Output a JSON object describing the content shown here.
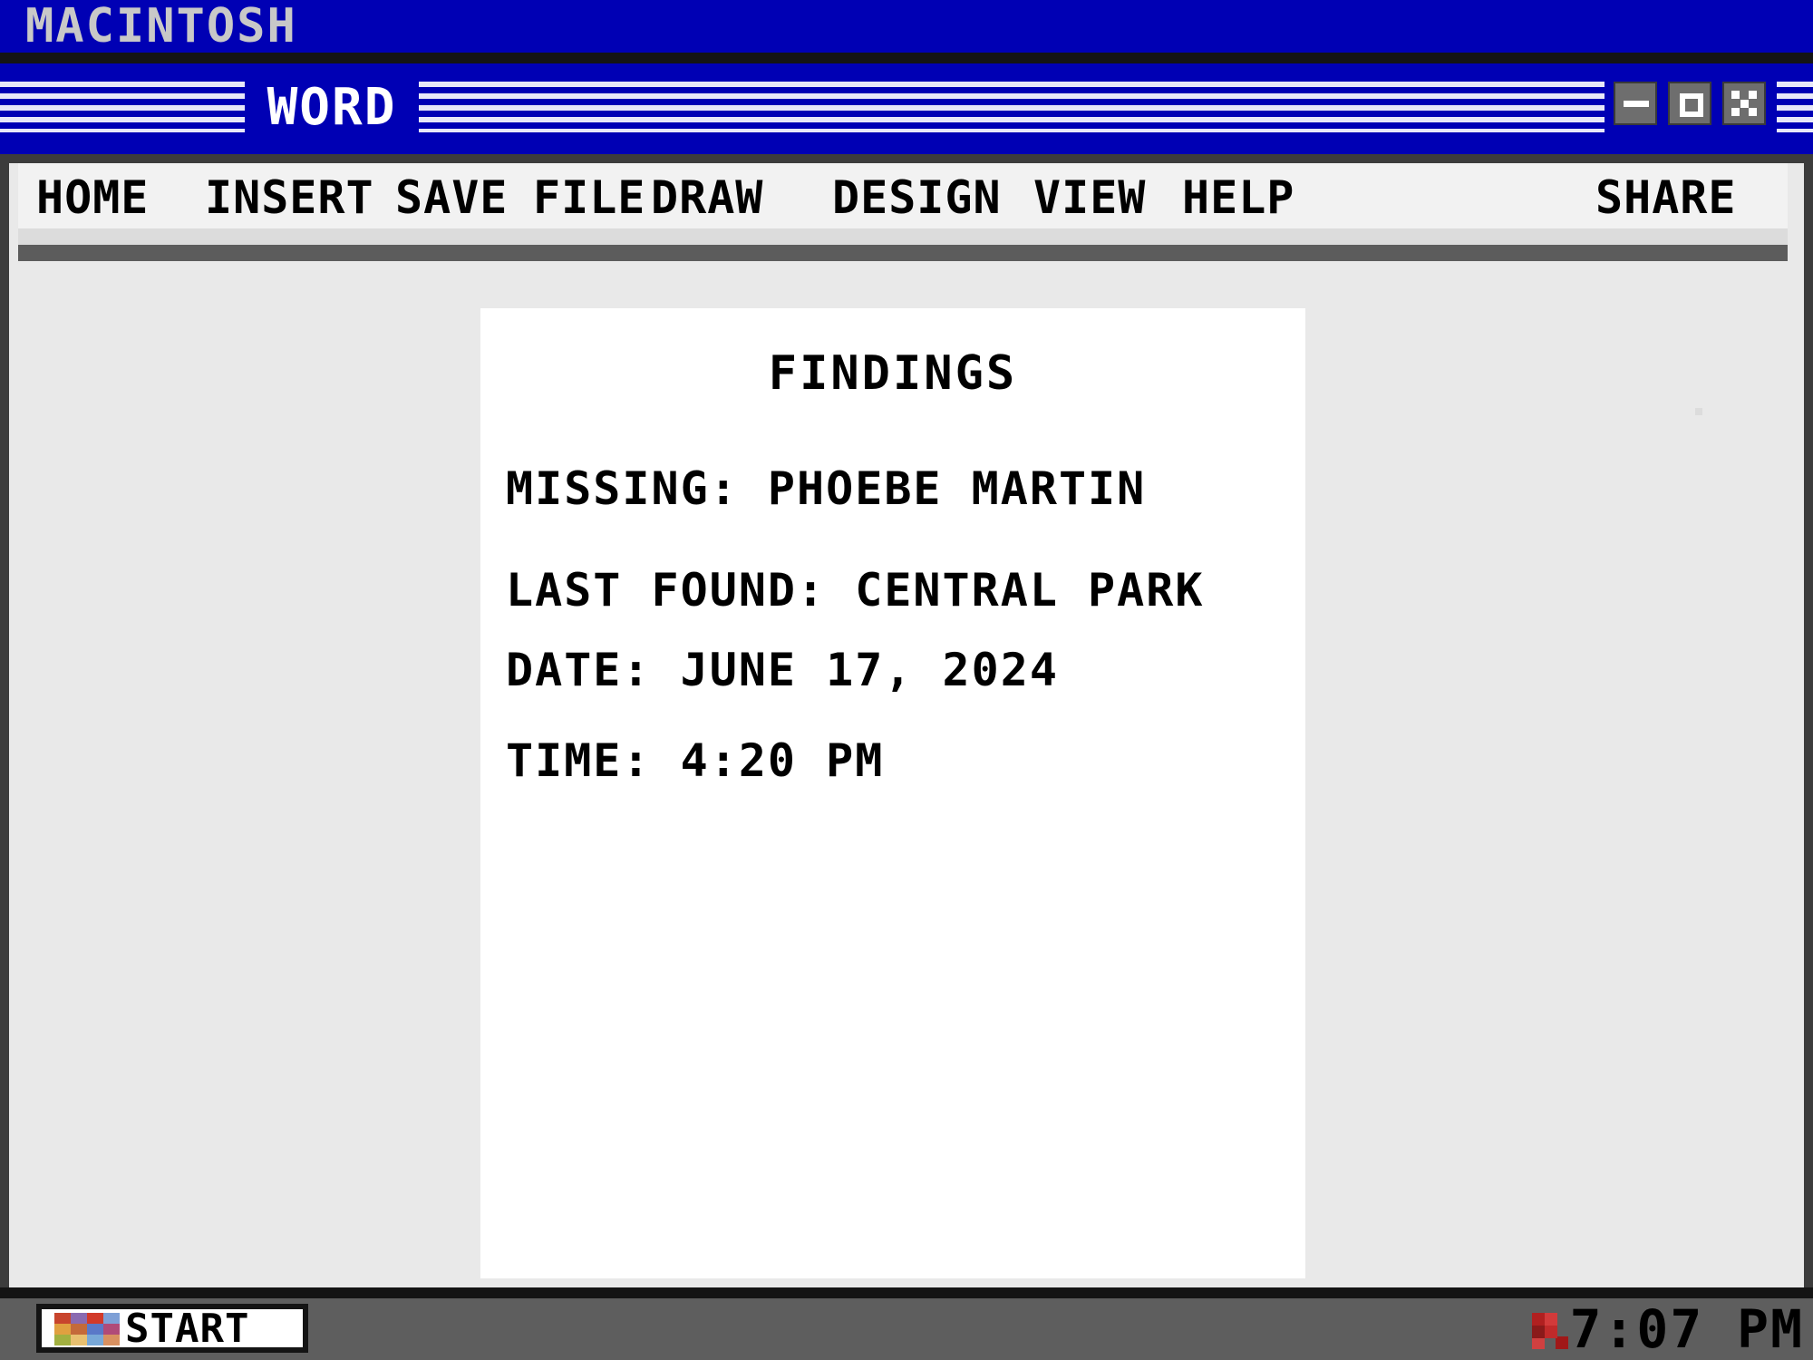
{
  "os_bar": {
    "title": "MACINTOSH"
  },
  "window": {
    "title": "WORD",
    "buttons": {
      "minimize": "minimize",
      "maximize": "maximize",
      "close": "close"
    }
  },
  "menu": {
    "items": [
      "HOME",
      "INSERT",
      "SAVE",
      "FILE",
      "DRAW",
      "DESIGN",
      "VIEW",
      "HELP"
    ],
    "share": "SHARE"
  },
  "document": {
    "title": "FINDINGS",
    "lines": [
      "MISSING: PHOEBE MARTIN",
      "LAST FOUND: CENTRAL PARK",
      "DATE: JUNE 17, 2024",
      "TIME: 4:20 PM"
    ]
  },
  "taskbar": {
    "start_label": "START",
    "clock": "7:07 PM"
  },
  "colors": {
    "accent": "#0000b4",
    "frame": "#3c3c3c",
    "taskbar": "#5e5e5e",
    "page": "#ffffff"
  },
  "icons": {
    "start_logo": "start-logo-icon",
    "tray": "tray-icon"
  }
}
